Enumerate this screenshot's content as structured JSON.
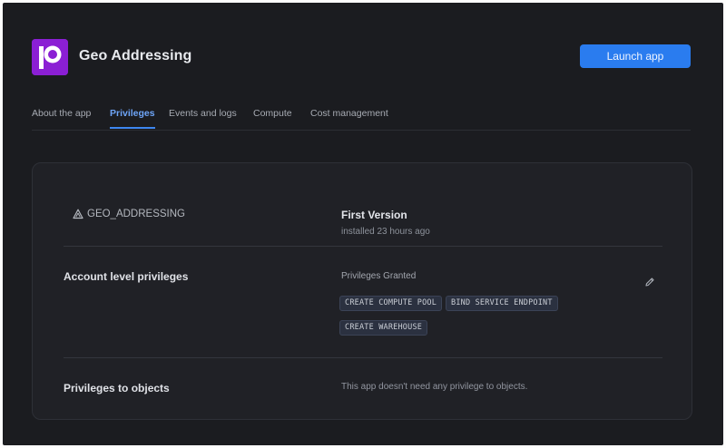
{
  "app": {
    "title": "Geo Addressing",
    "logo_color": "#8b1fd4",
    "launch_label": "Launch app",
    "accent": "#2a7cef"
  },
  "tabs": [
    {
      "label": "About the app",
      "active": false
    },
    {
      "label": "Privileges",
      "active": true
    },
    {
      "label": "Events and logs",
      "active": false
    },
    {
      "label": "Compute",
      "active": false
    },
    {
      "label": "Cost management",
      "active": false
    }
  ],
  "package": {
    "name": "GEO_ADDRESSING",
    "icon": "package-icon",
    "version_title": "First Version",
    "installed": "installed 23 hours ago"
  },
  "account_privileges": {
    "title": "Account level privileges",
    "granted_label": "Privileges Granted",
    "edit_icon": "pencil-icon",
    "chips": [
      "CREATE COMPUTE POOL",
      "BIND SERVICE ENDPOINT",
      "CREATE WAREHOUSE"
    ]
  },
  "object_privileges": {
    "title": "Privileges to objects",
    "message": "This app doesn't need any privilege to objects."
  }
}
